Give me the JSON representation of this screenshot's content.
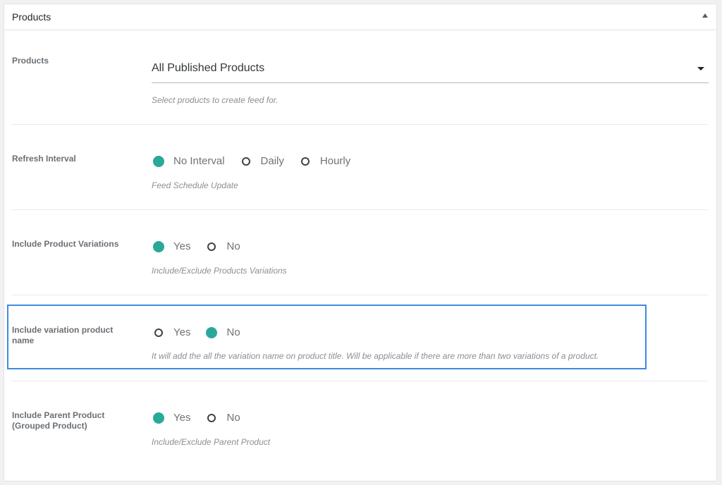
{
  "panel": {
    "title": "Products"
  },
  "fields": {
    "products": {
      "label": "Products",
      "selected": "All Published Products",
      "help": "Select products to create feed for."
    },
    "refresh_interval": {
      "label": "Refresh Interval",
      "options": [
        "No Interval",
        "Daily",
        "Hourly"
      ],
      "selected": "No Interval",
      "help": "Feed Schedule Update"
    },
    "include_variations": {
      "label": "Include Product Variations",
      "options": [
        "Yes",
        "No"
      ],
      "selected": "Yes",
      "help": "Include/Exclude Products Variations"
    },
    "include_variation_name": {
      "label": "Include variation product name",
      "options": [
        "Yes",
        "No"
      ],
      "selected": "No",
      "help": "It will add the all the variation name on product title. Will be applicable if there are more than two variations of a product."
    },
    "include_parent": {
      "label": "Include Parent Product (Grouped Product)",
      "options": [
        "Yes",
        "No"
      ],
      "selected": "Yes",
      "help": "Include/Exclude Parent Product"
    }
  },
  "colors": {
    "accent": "#2aa89a",
    "highlight_border": "#3f8ae0"
  }
}
